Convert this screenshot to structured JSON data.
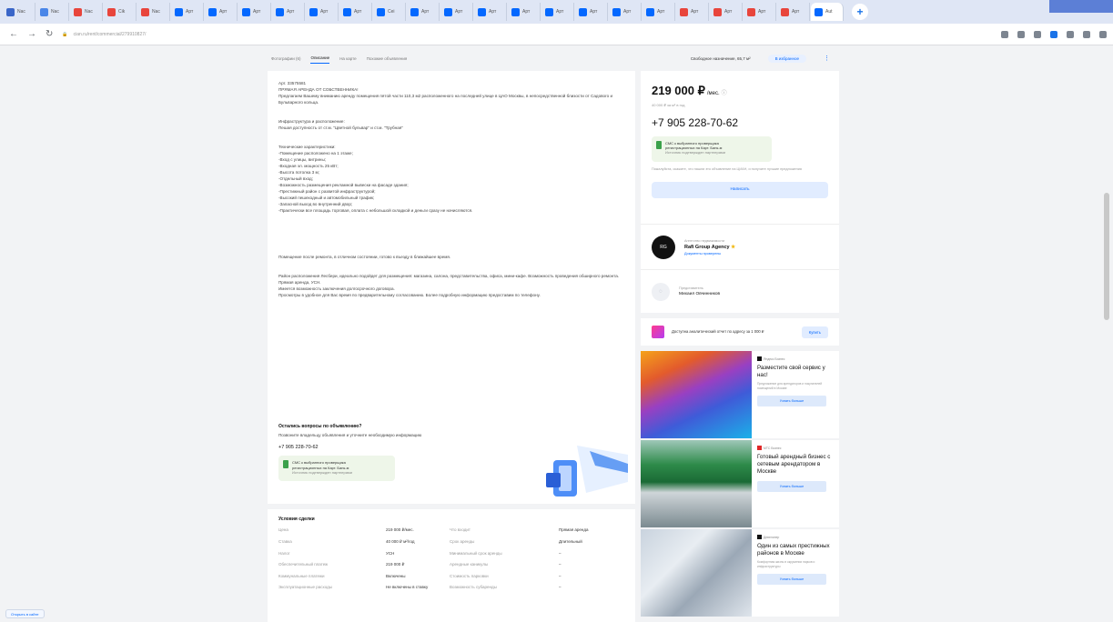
{
  "browser": {
    "tabs": [
      {
        "label": "Nac",
        "color": "#3a66c8"
      },
      {
        "label": "Nac",
        "color": "#4a86e8"
      },
      {
        "label": "Nac",
        "color": "#e8453c"
      },
      {
        "label": "Cik",
        "color": "#e8453c"
      },
      {
        "label": "Nac",
        "color": "#e8453c"
      },
      {
        "label": "Арт",
        "color": "#0468ff"
      },
      {
        "label": "Арт",
        "color": "#0468ff"
      },
      {
        "label": "Арт",
        "color": "#0468ff"
      },
      {
        "label": "Арт",
        "color": "#0468ff"
      },
      {
        "label": "Арт",
        "color": "#0468ff"
      },
      {
        "label": "Арт",
        "color": "#0468ff"
      },
      {
        "label": "Cei",
        "color": "#0468ff"
      },
      {
        "label": "Арт",
        "color": "#0468ff"
      },
      {
        "label": "Арт",
        "color": "#0468ff"
      },
      {
        "label": "Арт",
        "color": "#0468ff"
      },
      {
        "label": "Арт",
        "color": "#0468ff"
      },
      {
        "label": "Арт",
        "color": "#0468ff"
      },
      {
        "label": "Арт",
        "color": "#0468ff"
      },
      {
        "label": "Арт",
        "color": "#0468ff"
      },
      {
        "label": "Арт",
        "color": "#0468ff"
      },
      {
        "label": "Арт",
        "color": "#e8453c"
      },
      {
        "label": "Арт",
        "color": "#e8453c"
      },
      {
        "label": "Арт",
        "color": "#e8453c"
      },
      {
        "label": "Арт",
        "color": "#e8453c"
      },
      {
        "label": "Aut",
        "color": "#0468ff"
      }
    ],
    "new_tab_symbol": "+",
    "url": "cian.ru/rent/commercial/279910827/"
  },
  "subnav": {
    "items": [
      "Фотографии (6)",
      "Описание",
      "На карте",
      "Похожие объявления"
    ],
    "area_label": "Свободное назначение, 65,7 м²",
    "favorite_label": "В избранное"
  },
  "description": {
    "article": "Арт. 33575581",
    "headline": "ПРЯМАЯ АРЕНДА ОТ СОБСТВЕННИКА!",
    "intro": "Предлагаем Вашему вниманию аренду помещения пятой части 110,3 м2 расположенного на последней улице в ЦАО Москвы, в непосредственной близости от Садового и Бульварного кольца.",
    "infra_title": "Инфраструктура и расположение:",
    "infra_text": "Пешая доступность от ст.м. \"Цветной бульвар\" и ст.м. \"Трубная\"",
    "features_title": "Технические характеристики:",
    "features": [
      "-Помещение расположено на 1 этаже;",
      "-Вход с улицы, витрины;",
      "-Входная эл. мощность 25 кВт;",
      "-Высота потолка 3 м;",
      "-Отдельный вход;",
      "-Возможность размещения рекламной вывески на фасаде здания;",
      "-Престижный район с развитой инфраструктурой;",
      "-Высокий пешеходный и автомобильный трафик;",
      "-Запасной выход во внутренний двор;",
      "-Практически все площадь торговая, оплата с небольшой складкой и деньги сразу не начисляются."
    ],
    "condition": "Помещение после ремонта, в отличном состоянии, готово к въезду в ближайшее время.",
    "location_text": "Район расположения Лесбери, идеально подойдет для размещения: магазина, салона, представительства, офиса, мини-кафе. Возможность проведения обширного ремонта.",
    "direct_rent": "Прямая аренда, УСН.",
    "contract": "Имеется возможность заключения долгосрочного договора.",
    "viewing": "Просмотры в удобное для Вас время по предварительному согласованию. Более подробную информацию предоставим по телефону."
  },
  "questions": {
    "title": "Остались вопросы по объявлению?",
    "subtitle": "Позвоните владельцу объявления и уточните необходимую информацию",
    "phone": "+7 905 228-70-62",
    "verify_title": "СМС к выбранного проверщика",
    "verify_text": "регистрационных на Карт. Банк-м",
    "verify_note": "Источник подтвержден партнерами"
  },
  "terms": {
    "title": "Условия сделки",
    "rows": [
      {
        "k1": "Цена",
        "v1": "219 000 ₽/мес.",
        "k2": "Что входит",
        "v2": "Прямая аренда"
      },
      {
        "k1": "Ставка",
        "v1": "40 000 ₽ м²/год",
        "k2": "Срок аренды",
        "v2": "Длительный"
      },
      {
        "k1": "Налог",
        "v1": "УСН",
        "k2": "Минимальный срок аренды",
        "v2": "–"
      },
      {
        "k1": "Обеспечительный платеж",
        "v1": "219 000 ₽",
        "k2": "Арендные каникулы",
        "v2": "–"
      },
      {
        "k1": "Коммунальные платежи",
        "v1": "Включены",
        "k2": "Стоимость парковки",
        "v2": "–"
      },
      {
        "k1": "Эксплуатационные расходы",
        "v1": "Не включены в ставку",
        "k2": "Возможность субаренды",
        "v2": "–"
      }
    ]
  },
  "offer": {
    "price": "219 000 ₽",
    "price_unit": "/мес.",
    "price_sub": "40 000 ₽ за м² в год",
    "phone": "+7 905 228-70-62",
    "verify_title": "СМС к выбранного проверщика",
    "verify_text": "регистрационных на Карт. Банк-м",
    "verify_note": "Источник подтвержден партнерами",
    "note": "Пожалуйста, скажите, что нашли это объявление на ЦИАН, и получите лучшие предложения",
    "write_label": "Написать"
  },
  "agency": {
    "caption": "Агентство недвижимости",
    "name": "Rafi Group Agency",
    "logo_text": "RG",
    "docs": "Документы проверены"
  },
  "agent": {
    "role": "Представитель",
    "name": "Михаил Овчинников"
  },
  "promo": {
    "text": "Доступна аналитический отчет по адресу за 1 000 ₽",
    "button": "Купить"
  },
  "ads": [
    {
      "source": "Яндекс Бизнес",
      "title": "Разместите свой сервис у нас!",
      "desc": "Предложение для арендаторов и покупателей помещений в Москве",
      "button": "Узнать больше"
    },
    {
      "source": "МТС Бизнес",
      "title": "Готовый арендный бизнес с сетевым арендатором в Москве",
      "desc": "",
      "button": "Узнать больше"
    },
    {
      "source": "Девелопер",
      "title": "Один из самых престижных районов в Москве",
      "desc": "Комфортная жизнь в окружении парков и инфраструктуры",
      "button": "Узнать больше"
    }
  ],
  "bottom_link": "Открыть в сайте",
  "colors": {
    "accent": "#0468ff",
    "verify_bg": "#eef6e9",
    "shield": "#3ba14b"
  }
}
